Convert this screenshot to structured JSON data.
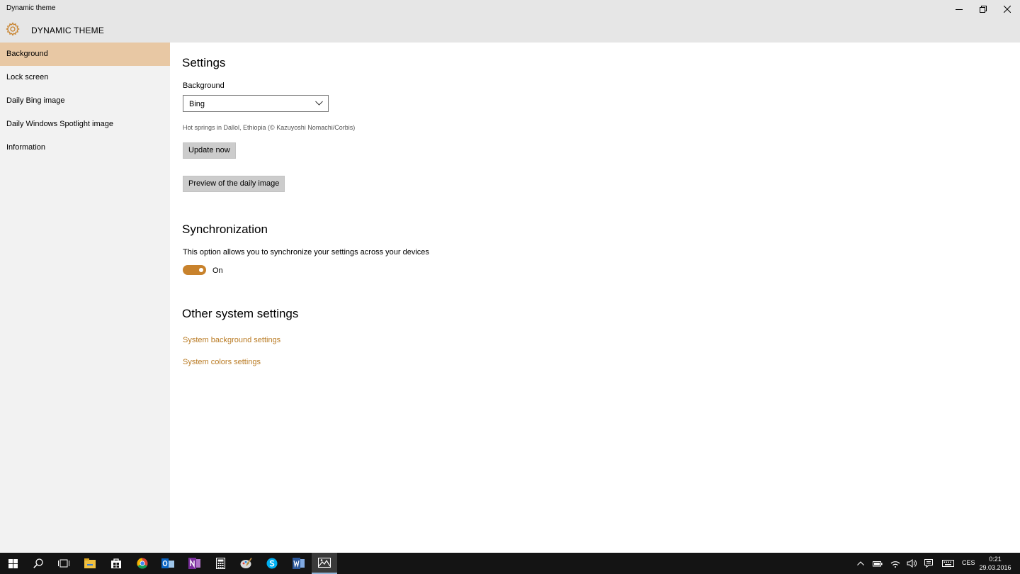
{
  "window": {
    "title": "Dynamic theme"
  },
  "app": {
    "title": "DYNAMIC THEME",
    "icon": "gear-icon"
  },
  "sidebar": {
    "items": [
      {
        "label": "Background",
        "selected": true
      },
      {
        "label": "Lock screen",
        "selected": false
      },
      {
        "label": "Daily Bing image",
        "selected": false
      },
      {
        "label": "Daily Windows Spotlight image",
        "selected": false
      },
      {
        "label": "Information",
        "selected": false
      }
    ]
  },
  "settings": {
    "heading": "Settings",
    "background_label": "Background",
    "background_value": "Bing",
    "image_caption": "Hot springs in Dallol, Ethiopia (© Kazuyoshi Nomachi/Corbis)",
    "update_button": "Update now",
    "preview_button": "Preview of the daily image"
  },
  "sync": {
    "heading": "Synchronization",
    "description": "This option allows you to synchronize your settings across your devices",
    "toggle_state": "On"
  },
  "other": {
    "heading": "Other system settings",
    "links": [
      "System background settings",
      "System colors settings"
    ]
  },
  "taskbar": {
    "apps": [
      "windows-start-icon",
      "search-icon",
      "task-view-icon",
      "file-explorer-icon",
      "store-icon",
      "chrome-icon",
      "outlook-icon",
      "onenote-icon",
      "calculator-icon",
      "paint-icon",
      "skype-icon",
      "word-icon",
      "dynamic-theme-icon"
    ],
    "language": "CES",
    "time": "0:21",
    "date": "29.03.2016"
  },
  "colors": {
    "accent": "#c8822c",
    "selected_nav": "#e8c8a4",
    "link": "#b97a22"
  }
}
